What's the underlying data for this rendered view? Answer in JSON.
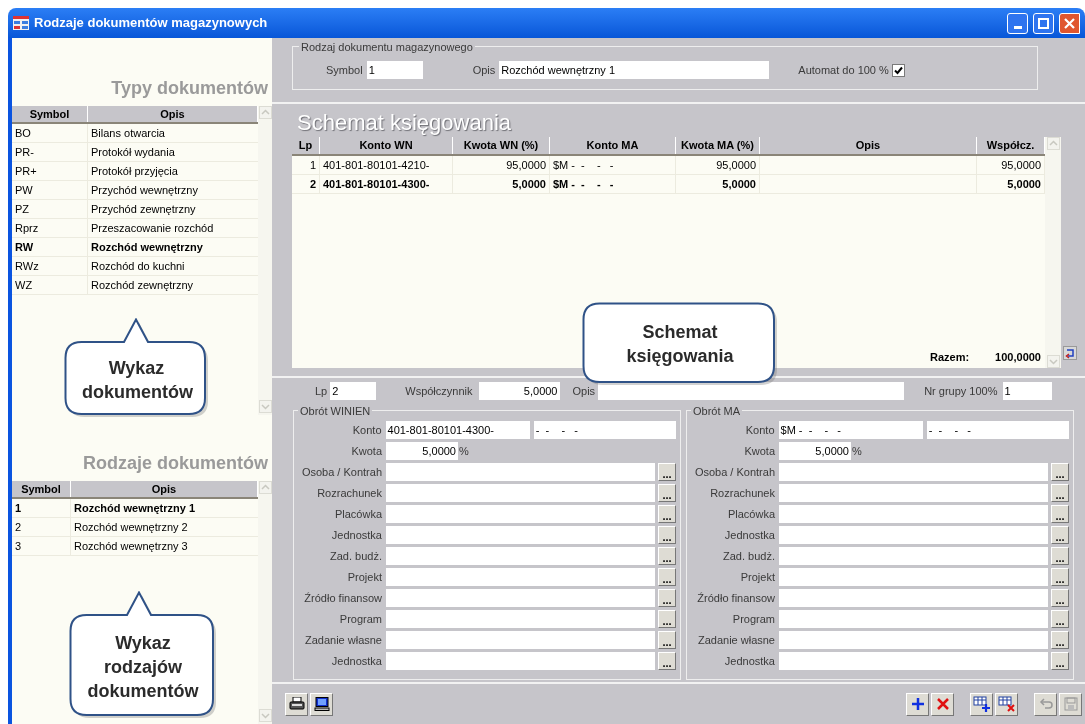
{
  "window": {
    "title": "Rodzaje dokumentów magazynowych"
  },
  "types_panel": {
    "title": "Typy dokumentów",
    "columns": [
      "Symbol",
      "Opis"
    ],
    "rows": [
      {
        "symbol": "BO",
        "opis": "Bilans otwarcia",
        "selected": false
      },
      {
        "symbol": "PR-",
        "opis": "Protokół wydania",
        "selected": false
      },
      {
        "symbol": "PR+",
        "opis": "Protokół przyjęcia",
        "selected": false
      },
      {
        "symbol": "PW",
        "opis": "Przychód wewnętrzny",
        "selected": false
      },
      {
        "symbol": "PZ",
        "opis": "Przychód zewnętrzny",
        "selected": false
      },
      {
        "symbol": "Rprz",
        "opis": "Przeszacowanie rozchód",
        "selected": false
      },
      {
        "symbol": "RW",
        "opis": "Rozchód wewnętrzny",
        "selected": true
      },
      {
        "symbol": "RWz",
        "opis": "Rozchód do kuchni",
        "selected": false
      },
      {
        "symbol": "WZ",
        "opis": "Rozchód zewnętrzny",
        "selected": false
      }
    ],
    "callout": "Wykaz dokumentów"
  },
  "kinds_panel": {
    "title": "Rodzaje dokumentów",
    "columns": [
      "Symbol",
      "Opis"
    ],
    "rows": [
      {
        "symbol": "1",
        "opis": "Rozchód wewnętrzny 1",
        "selected": true
      },
      {
        "symbol": "2",
        "opis": "Rozchód wewnętrzny 2",
        "selected": false
      },
      {
        "symbol": "3",
        "opis": "Rozchód wewnętrzny 3",
        "selected": false
      }
    ],
    "callout": "Wykaz rodzajów dokumentów"
  },
  "header": {
    "group_title": "Rodzaj dokumentu magazynowego",
    "symbol_label": "Symbol",
    "symbol_value": "1",
    "opis_label": "Opis",
    "opis_value": "Rozchód wewnętrzny 1",
    "automat_label": "Automat do 100 %",
    "automat_checked": true
  },
  "scheme": {
    "title": "Schemat księgowania",
    "columns": [
      "Lp",
      "Konto WN",
      "Kwota WN (%)",
      "Konto MA",
      "Kwota MA (%)",
      "Opis",
      "Współcz."
    ],
    "rows": [
      {
        "lp": "1",
        "konto_wn": "401-801-80101-4210-",
        "kwota_wn": "95,0000",
        "konto_ma": "$M -  -    -   -",
        "kwota_ma": "95,0000",
        "wspolcz": "95,0000",
        "selected": false
      },
      {
        "lp": "2",
        "konto_wn": "401-801-80101-4300-",
        "kwota_wn": "5,0000",
        "konto_ma": "$M -  -    -   -",
        "kwota_ma": "5,0000",
        "wspolcz": "5,0000",
        "selected": true
      }
    ],
    "total_label": "Razem:",
    "total_value": "100,0000",
    "callout": "Schemat księgowania"
  },
  "detail": {
    "lp_label": "Lp",
    "lp_value": "2",
    "coef_label": "Współczynnik",
    "coef_value": "5,0000",
    "opis_label": "Opis",
    "group_label": "Nr grupy 100%",
    "group_value": "1",
    "sides": [
      {
        "title": "Obrót WINIEN",
        "konto_label": "Konto",
        "konto_value": "401-801-80101-4300-",
        "konto_value_2": "-  -    -   -",
        "kwota_label": "Kwota",
        "kwota_value": "5,0000",
        "kwota_unit": "%",
        "fields": [
          {
            "label": "Osoba / Kontrah",
            "button": "..."
          },
          {
            "label": "Rozrachunek",
            "button": "..."
          },
          {
            "label": "Placówka",
            "button": "..."
          },
          {
            "label": "Jednostka",
            "button": "..."
          },
          {
            "label": "Zad. budż.",
            "button": "..."
          },
          {
            "label": "Projekt",
            "button": "..."
          },
          {
            "label": "Źródło finansow",
            "button": "..."
          },
          {
            "label": "Program",
            "button": "..."
          },
          {
            "label": "Zadanie własne",
            "button": "..."
          },
          {
            "label": "Jednostka",
            "button": "..."
          }
        ]
      },
      {
        "title": "Obrót MA",
        "konto_label": "Konto",
        "konto_value": "$M -  -    -   -",
        "konto_value_2": "-  -    -   -",
        "kwota_label": "Kwota",
        "kwota_value": "5,0000",
        "kwota_unit": "%",
        "fields": [
          {
            "label": "Osoba / Kontrah",
            "button": "..."
          },
          {
            "label": "Rozrachunek",
            "button": "..."
          },
          {
            "label": "Placówka",
            "button": "..."
          },
          {
            "label": "Jednostka",
            "button": "..."
          },
          {
            "label": "Zad. budż.",
            "button": "..."
          },
          {
            "label": "Projekt",
            "button": "..."
          },
          {
            "label": "Źródło finansow",
            "button": "..."
          },
          {
            "label": "Program",
            "button": "..."
          },
          {
            "label": "Zadanie własne",
            "button": "..."
          },
          {
            "label": "Jednostka",
            "button": "..."
          }
        ]
      }
    ]
  }
}
